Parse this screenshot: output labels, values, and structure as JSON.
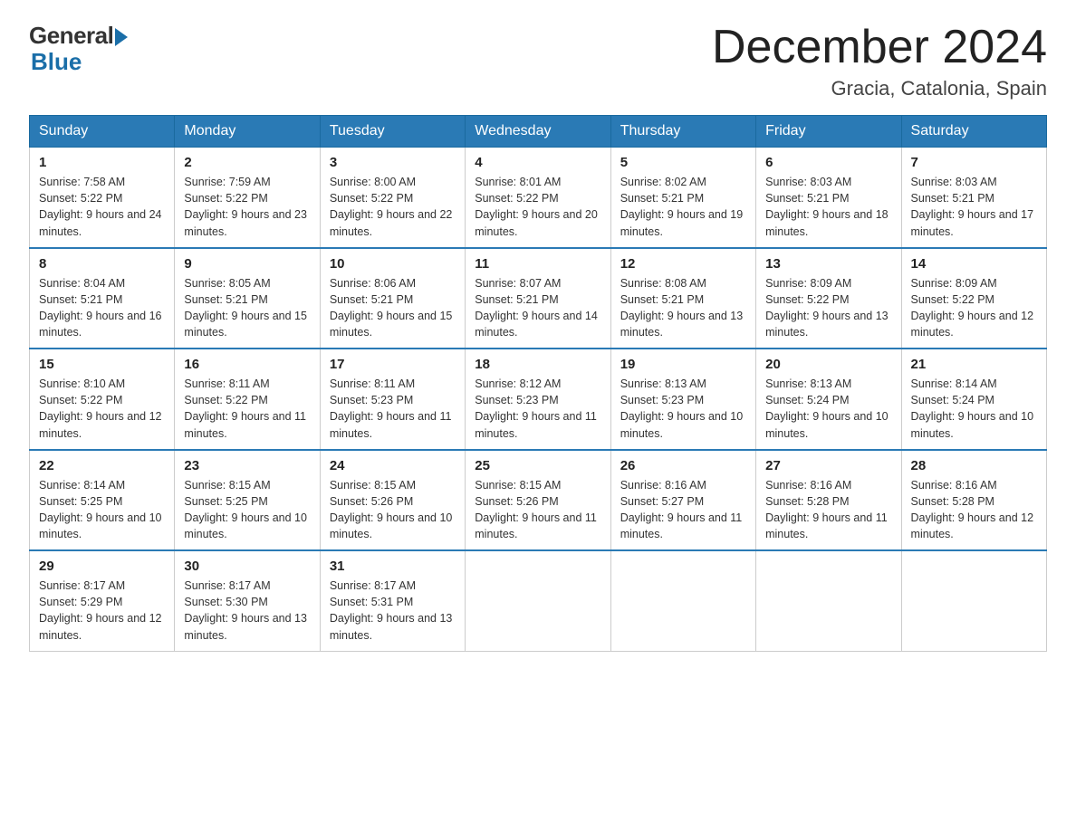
{
  "logo": {
    "text_general": "General",
    "text_blue": "Blue"
  },
  "title": {
    "month_year": "December 2024",
    "location": "Gracia, Catalonia, Spain"
  },
  "weekdays": [
    "Sunday",
    "Monday",
    "Tuesday",
    "Wednesday",
    "Thursday",
    "Friday",
    "Saturday"
  ],
  "weeks": [
    [
      {
        "day": "1",
        "sunrise": "7:58 AM",
        "sunset": "5:22 PM",
        "daylight": "9 hours and 24 minutes."
      },
      {
        "day": "2",
        "sunrise": "7:59 AM",
        "sunset": "5:22 PM",
        "daylight": "9 hours and 23 minutes."
      },
      {
        "day": "3",
        "sunrise": "8:00 AM",
        "sunset": "5:22 PM",
        "daylight": "9 hours and 22 minutes."
      },
      {
        "day": "4",
        "sunrise": "8:01 AM",
        "sunset": "5:22 PM",
        "daylight": "9 hours and 20 minutes."
      },
      {
        "day": "5",
        "sunrise": "8:02 AM",
        "sunset": "5:21 PM",
        "daylight": "9 hours and 19 minutes."
      },
      {
        "day": "6",
        "sunrise": "8:03 AM",
        "sunset": "5:21 PM",
        "daylight": "9 hours and 18 minutes."
      },
      {
        "day": "7",
        "sunrise": "8:03 AM",
        "sunset": "5:21 PM",
        "daylight": "9 hours and 17 minutes."
      }
    ],
    [
      {
        "day": "8",
        "sunrise": "8:04 AM",
        "sunset": "5:21 PM",
        "daylight": "9 hours and 16 minutes."
      },
      {
        "day": "9",
        "sunrise": "8:05 AM",
        "sunset": "5:21 PM",
        "daylight": "9 hours and 15 minutes."
      },
      {
        "day": "10",
        "sunrise": "8:06 AM",
        "sunset": "5:21 PM",
        "daylight": "9 hours and 15 minutes."
      },
      {
        "day": "11",
        "sunrise": "8:07 AM",
        "sunset": "5:21 PM",
        "daylight": "9 hours and 14 minutes."
      },
      {
        "day": "12",
        "sunrise": "8:08 AM",
        "sunset": "5:21 PM",
        "daylight": "9 hours and 13 minutes."
      },
      {
        "day": "13",
        "sunrise": "8:09 AM",
        "sunset": "5:22 PM",
        "daylight": "9 hours and 13 minutes."
      },
      {
        "day": "14",
        "sunrise": "8:09 AM",
        "sunset": "5:22 PM",
        "daylight": "9 hours and 12 minutes."
      }
    ],
    [
      {
        "day": "15",
        "sunrise": "8:10 AM",
        "sunset": "5:22 PM",
        "daylight": "9 hours and 12 minutes."
      },
      {
        "day": "16",
        "sunrise": "8:11 AM",
        "sunset": "5:22 PM",
        "daylight": "9 hours and 11 minutes."
      },
      {
        "day": "17",
        "sunrise": "8:11 AM",
        "sunset": "5:23 PM",
        "daylight": "9 hours and 11 minutes."
      },
      {
        "day": "18",
        "sunrise": "8:12 AM",
        "sunset": "5:23 PM",
        "daylight": "9 hours and 11 minutes."
      },
      {
        "day": "19",
        "sunrise": "8:13 AM",
        "sunset": "5:23 PM",
        "daylight": "9 hours and 10 minutes."
      },
      {
        "day": "20",
        "sunrise": "8:13 AM",
        "sunset": "5:24 PM",
        "daylight": "9 hours and 10 minutes."
      },
      {
        "day": "21",
        "sunrise": "8:14 AM",
        "sunset": "5:24 PM",
        "daylight": "9 hours and 10 minutes."
      }
    ],
    [
      {
        "day": "22",
        "sunrise": "8:14 AM",
        "sunset": "5:25 PM",
        "daylight": "9 hours and 10 minutes."
      },
      {
        "day": "23",
        "sunrise": "8:15 AM",
        "sunset": "5:25 PM",
        "daylight": "9 hours and 10 minutes."
      },
      {
        "day": "24",
        "sunrise": "8:15 AM",
        "sunset": "5:26 PM",
        "daylight": "9 hours and 10 minutes."
      },
      {
        "day": "25",
        "sunrise": "8:15 AM",
        "sunset": "5:26 PM",
        "daylight": "9 hours and 11 minutes."
      },
      {
        "day": "26",
        "sunrise": "8:16 AM",
        "sunset": "5:27 PM",
        "daylight": "9 hours and 11 minutes."
      },
      {
        "day": "27",
        "sunrise": "8:16 AM",
        "sunset": "5:28 PM",
        "daylight": "9 hours and 11 minutes."
      },
      {
        "day": "28",
        "sunrise": "8:16 AM",
        "sunset": "5:28 PM",
        "daylight": "9 hours and 12 minutes."
      }
    ],
    [
      {
        "day": "29",
        "sunrise": "8:17 AM",
        "sunset": "5:29 PM",
        "daylight": "9 hours and 12 minutes."
      },
      {
        "day": "30",
        "sunrise": "8:17 AM",
        "sunset": "5:30 PM",
        "daylight": "9 hours and 13 minutes."
      },
      {
        "day": "31",
        "sunrise": "8:17 AM",
        "sunset": "5:31 PM",
        "daylight": "9 hours and 13 minutes."
      },
      null,
      null,
      null,
      null
    ]
  ]
}
